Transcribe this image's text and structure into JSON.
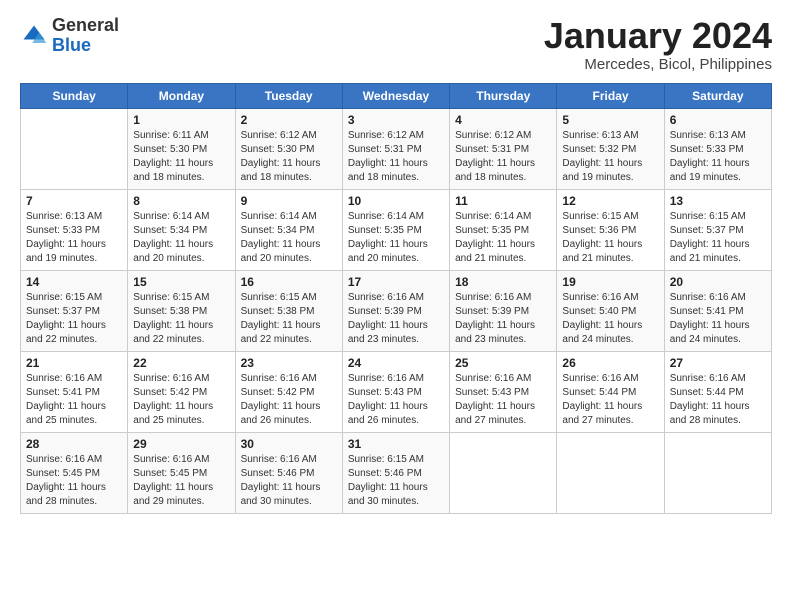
{
  "logo": {
    "general": "General",
    "blue": "Blue"
  },
  "header": {
    "title": "January 2024",
    "subtitle": "Mercedes, Bicol, Philippines"
  },
  "days_of_week": [
    "Sunday",
    "Monday",
    "Tuesday",
    "Wednesday",
    "Thursday",
    "Friday",
    "Saturday"
  ],
  "weeks": [
    [
      {
        "day": "",
        "info": ""
      },
      {
        "day": "1",
        "info": "Sunrise: 6:11 AM\nSunset: 5:30 PM\nDaylight: 11 hours\nand 18 minutes."
      },
      {
        "day": "2",
        "info": "Sunrise: 6:12 AM\nSunset: 5:30 PM\nDaylight: 11 hours\nand 18 minutes."
      },
      {
        "day": "3",
        "info": "Sunrise: 6:12 AM\nSunset: 5:31 PM\nDaylight: 11 hours\nand 18 minutes."
      },
      {
        "day": "4",
        "info": "Sunrise: 6:12 AM\nSunset: 5:31 PM\nDaylight: 11 hours\nand 18 minutes."
      },
      {
        "day": "5",
        "info": "Sunrise: 6:13 AM\nSunset: 5:32 PM\nDaylight: 11 hours\nand 19 minutes."
      },
      {
        "day": "6",
        "info": "Sunrise: 6:13 AM\nSunset: 5:33 PM\nDaylight: 11 hours\nand 19 minutes."
      }
    ],
    [
      {
        "day": "7",
        "info": "Sunrise: 6:13 AM\nSunset: 5:33 PM\nDaylight: 11 hours\nand 19 minutes."
      },
      {
        "day": "8",
        "info": "Sunrise: 6:14 AM\nSunset: 5:34 PM\nDaylight: 11 hours\nand 20 minutes."
      },
      {
        "day": "9",
        "info": "Sunrise: 6:14 AM\nSunset: 5:34 PM\nDaylight: 11 hours\nand 20 minutes."
      },
      {
        "day": "10",
        "info": "Sunrise: 6:14 AM\nSunset: 5:35 PM\nDaylight: 11 hours\nand 20 minutes."
      },
      {
        "day": "11",
        "info": "Sunrise: 6:14 AM\nSunset: 5:35 PM\nDaylight: 11 hours\nand 21 minutes."
      },
      {
        "day": "12",
        "info": "Sunrise: 6:15 AM\nSunset: 5:36 PM\nDaylight: 11 hours\nand 21 minutes."
      },
      {
        "day": "13",
        "info": "Sunrise: 6:15 AM\nSunset: 5:37 PM\nDaylight: 11 hours\nand 21 minutes."
      }
    ],
    [
      {
        "day": "14",
        "info": "Sunrise: 6:15 AM\nSunset: 5:37 PM\nDaylight: 11 hours\nand 22 minutes."
      },
      {
        "day": "15",
        "info": "Sunrise: 6:15 AM\nSunset: 5:38 PM\nDaylight: 11 hours\nand 22 minutes."
      },
      {
        "day": "16",
        "info": "Sunrise: 6:15 AM\nSunset: 5:38 PM\nDaylight: 11 hours\nand 22 minutes."
      },
      {
        "day": "17",
        "info": "Sunrise: 6:16 AM\nSunset: 5:39 PM\nDaylight: 11 hours\nand 23 minutes."
      },
      {
        "day": "18",
        "info": "Sunrise: 6:16 AM\nSunset: 5:39 PM\nDaylight: 11 hours\nand 23 minutes."
      },
      {
        "day": "19",
        "info": "Sunrise: 6:16 AM\nSunset: 5:40 PM\nDaylight: 11 hours\nand 24 minutes."
      },
      {
        "day": "20",
        "info": "Sunrise: 6:16 AM\nSunset: 5:41 PM\nDaylight: 11 hours\nand 24 minutes."
      }
    ],
    [
      {
        "day": "21",
        "info": "Sunrise: 6:16 AM\nSunset: 5:41 PM\nDaylight: 11 hours\nand 25 minutes."
      },
      {
        "day": "22",
        "info": "Sunrise: 6:16 AM\nSunset: 5:42 PM\nDaylight: 11 hours\nand 25 minutes."
      },
      {
        "day": "23",
        "info": "Sunrise: 6:16 AM\nSunset: 5:42 PM\nDaylight: 11 hours\nand 26 minutes."
      },
      {
        "day": "24",
        "info": "Sunrise: 6:16 AM\nSunset: 5:43 PM\nDaylight: 11 hours\nand 26 minutes."
      },
      {
        "day": "25",
        "info": "Sunrise: 6:16 AM\nSunset: 5:43 PM\nDaylight: 11 hours\nand 27 minutes."
      },
      {
        "day": "26",
        "info": "Sunrise: 6:16 AM\nSunset: 5:44 PM\nDaylight: 11 hours\nand 27 minutes."
      },
      {
        "day": "27",
        "info": "Sunrise: 6:16 AM\nSunset: 5:44 PM\nDaylight: 11 hours\nand 28 minutes."
      }
    ],
    [
      {
        "day": "28",
        "info": "Sunrise: 6:16 AM\nSunset: 5:45 PM\nDaylight: 11 hours\nand 28 minutes."
      },
      {
        "day": "29",
        "info": "Sunrise: 6:16 AM\nSunset: 5:45 PM\nDaylight: 11 hours\nand 29 minutes."
      },
      {
        "day": "30",
        "info": "Sunrise: 6:16 AM\nSunset: 5:46 PM\nDaylight: 11 hours\nand 30 minutes."
      },
      {
        "day": "31",
        "info": "Sunrise: 6:15 AM\nSunset: 5:46 PM\nDaylight: 11 hours\nand 30 minutes."
      },
      {
        "day": "",
        "info": ""
      },
      {
        "day": "",
        "info": ""
      },
      {
        "day": "",
        "info": ""
      }
    ]
  ]
}
